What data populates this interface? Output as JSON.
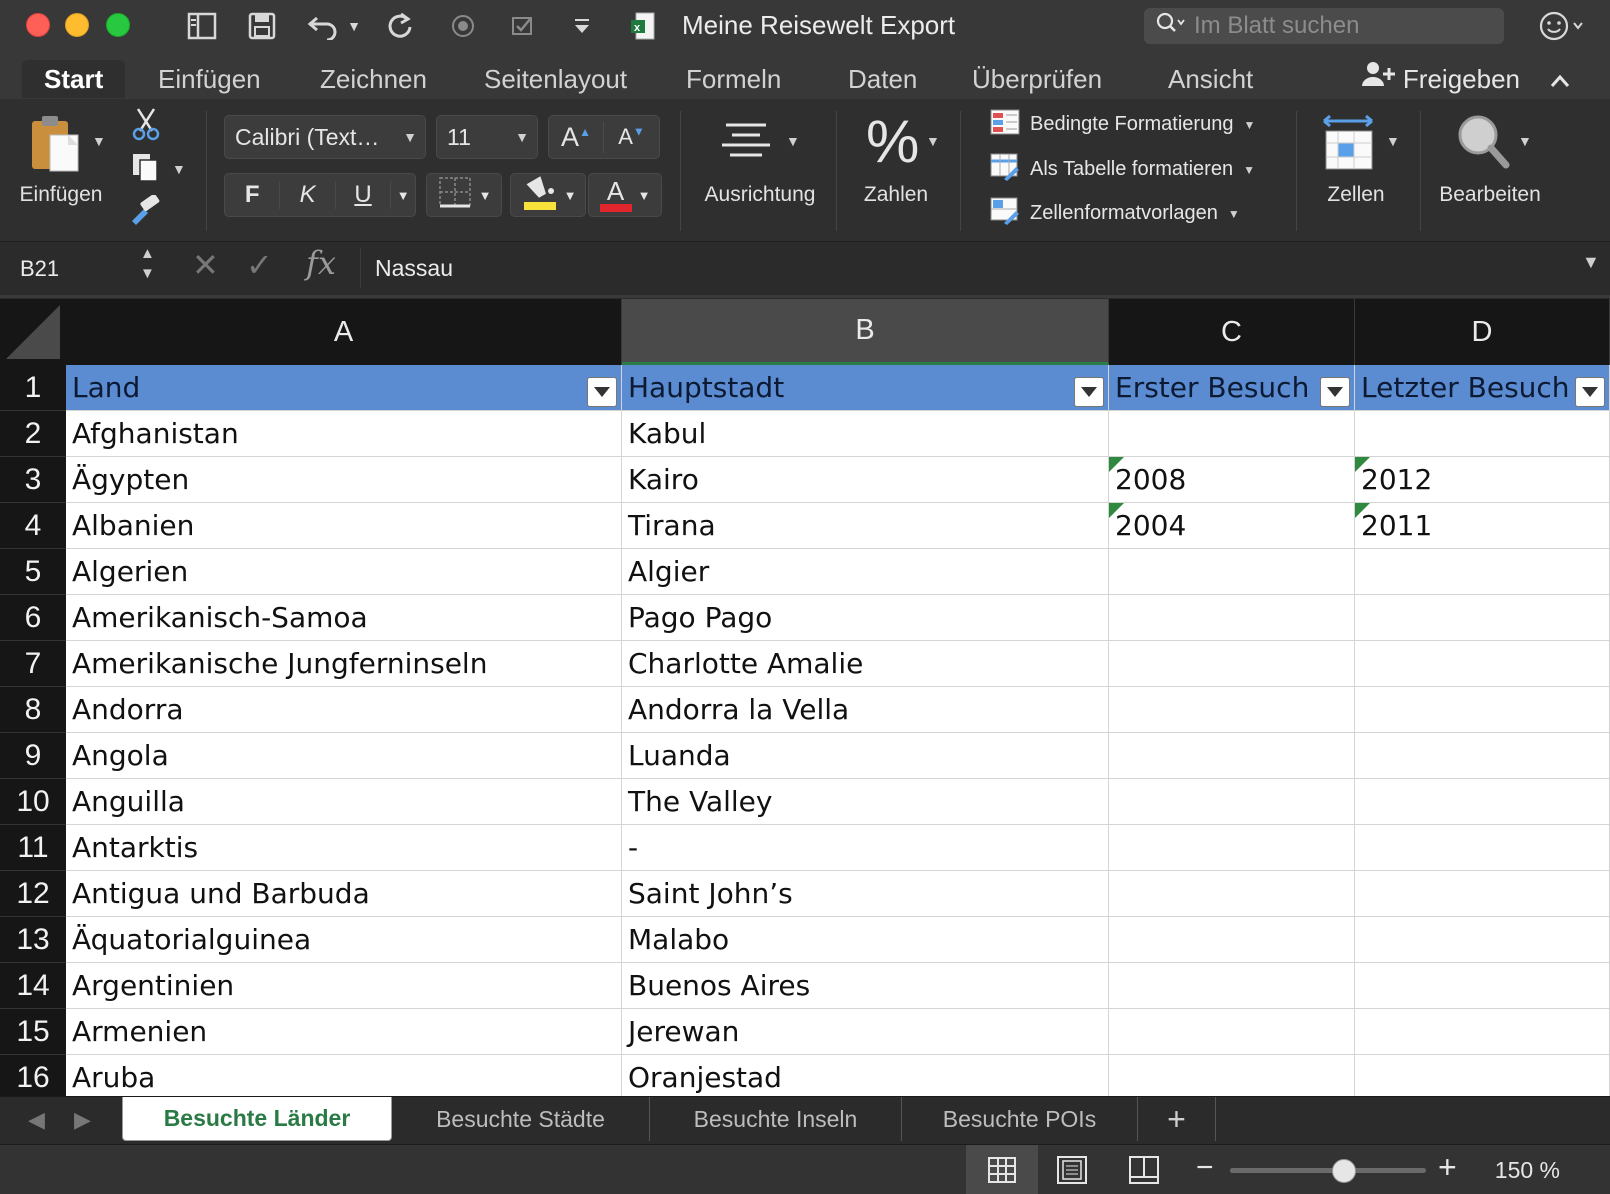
{
  "window": {
    "title": "Meine Reisewelt Export",
    "search_placeholder": "Im Blatt suchen"
  },
  "ribbon_tabs": [
    "Start",
    "Einfügen",
    "Zeichnen",
    "Seitenlayout",
    "Formeln",
    "Daten",
    "Überprüfen",
    "Ansicht"
  ],
  "active_tab": "Start",
  "share_label": "Freigeben",
  "ribbon": {
    "paste_label": "Einfügen",
    "font_name": "Calibri (Text…",
    "font_size": "11",
    "bold": "F",
    "italic": "K",
    "underline": "U",
    "grow_font": "A",
    "shrink_font": "A",
    "font_color_letter": "A",
    "alignment_label": "Ausrichtung",
    "number_label": "Zahlen",
    "number_symbol": "%",
    "conditional_formatting": "Bedingte Formatierung",
    "format_as_table": "Als Tabelle formatieren",
    "cell_styles": "Zellenformatvorlagen",
    "cells_label": "Zellen",
    "editing_label": "Bearbeiten",
    "fill_color": "#f7e23b",
    "font_color": "#e0262c"
  },
  "formula_bar": {
    "name_box": "B21",
    "fx": "fx",
    "value": "Nassau"
  },
  "columns": [
    "A",
    "B",
    "C",
    "D"
  ],
  "selected_column": "B",
  "table": {
    "headers": [
      "Land",
      "Hauptstadt",
      "Erster Besuch",
      "Letzter Besuch"
    ],
    "header_color": "#5b8cd2",
    "rows": [
      {
        "num": "1"
      },
      {
        "num": "2",
        "land": "Afghanistan",
        "hauptstadt": "Kabul",
        "erster": "",
        "letzter": ""
      },
      {
        "num": "3",
        "land": "Ägypten",
        "hauptstadt": "Kairo",
        "erster": "2008",
        "letzter": "2012"
      },
      {
        "num": "4",
        "land": "Albanien",
        "hauptstadt": "Tirana",
        "erster": "2004",
        "letzter": "2011"
      },
      {
        "num": "5",
        "land": "Algerien",
        "hauptstadt": "Algier",
        "erster": "",
        "letzter": ""
      },
      {
        "num": "6",
        "land": "Amerikanisch-Samoa",
        "hauptstadt": "Pago Pago",
        "erster": "",
        "letzter": ""
      },
      {
        "num": "7",
        "land": "Amerikanische Jungferninseln",
        "hauptstadt": "Charlotte Amalie",
        "erster": "",
        "letzter": ""
      },
      {
        "num": "8",
        "land": "Andorra",
        "hauptstadt": "Andorra la Vella",
        "erster": "",
        "letzter": ""
      },
      {
        "num": "9",
        "land": "Angola",
        "hauptstadt": "Luanda",
        "erster": "",
        "letzter": ""
      },
      {
        "num": "10",
        "land": "Anguilla",
        "hauptstadt": "The Valley",
        "erster": "",
        "letzter": ""
      },
      {
        "num": "11",
        "land": "Antarktis",
        "hauptstadt": "-",
        "erster": "",
        "letzter": ""
      },
      {
        "num": "12",
        "land": "Antigua und Barbuda",
        "hauptstadt": "Saint John’s",
        "erster": "",
        "letzter": ""
      },
      {
        "num": "13",
        "land": "Äquatorialguinea",
        "hauptstadt": "Malabo",
        "erster": "",
        "letzter": ""
      },
      {
        "num": "14",
        "land": "Argentinien",
        "hauptstadt": "Buenos Aires",
        "erster": "",
        "letzter": ""
      },
      {
        "num": "15",
        "land": "Armenien",
        "hauptstadt": "Jerewan",
        "erster": "",
        "letzter": ""
      },
      {
        "num": "16",
        "land": "Aruba",
        "hauptstadt": "Oranjestad",
        "erster": "",
        "letzter": ""
      }
    ]
  },
  "sheet_tabs": [
    "Besuchte Länder",
    "Besuchte Städte",
    "Besuchte Inseln",
    "Besuchte POIs"
  ],
  "active_sheet": "Besuchte Länder",
  "add_sheet": "+",
  "status": {
    "zoom": "150 %",
    "zoom_level": 0.58
  }
}
